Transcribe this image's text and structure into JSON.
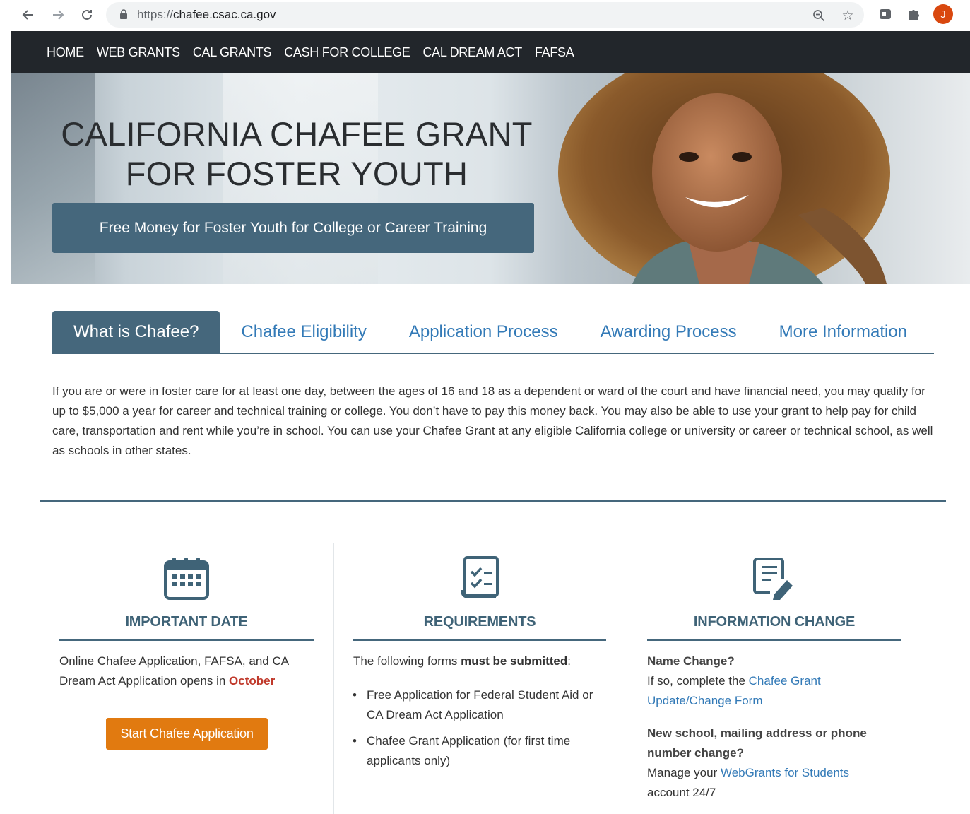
{
  "browser": {
    "url_scheme": "https://",
    "url_host": "chafee.csac.ca.gov",
    "avatar_initial": "J",
    "icons": [
      "back-icon",
      "forward-icon",
      "reload-icon",
      "lock-icon",
      "zoom-icon",
      "star-icon",
      "extension-icon",
      "puzzle-icon"
    ]
  },
  "site_nav": {
    "items": [
      "HOME",
      "WEB GRANTS",
      "CAL GRANTS",
      "CASH FOR COLLEGE",
      "CAL DREAM ACT",
      "FAFSA"
    ]
  },
  "hero": {
    "title_line1": "CALIFORNIA CHAFEE GRANT",
    "title_line2": "FOR FOSTER YOUTH",
    "cta": "Free Money for Foster Youth for College or Career Training"
  },
  "tabs": [
    {
      "label": "What is Chafee?",
      "active": true
    },
    {
      "label": "Chafee Eligibility",
      "active": false
    },
    {
      "label": "Application Process",
      "active": false
    },
    {
      "label": "Awarding Process",
      "active": false
    },
    {
      "label": "More Information",
      "active": false
    }
  ],
  "intro": "If you are or were in foster care for at least one day, between the ages of 16 and 18 as a dependent or ward of the court and have financial need, you may qualify for up to $5,000 a year for career and technical training or college. You don’t have to pay this money back. You may also be able to use your grant to help pay for child care, transportation and rent while you’re in school. You can use your Chafee Grant at any eligible California college or university or career or technical school, as well as schools in other states.",
  "cards": {
    "important_date": {
      "title": "IMPORTANT DATE",
      "text_before": "Online Chafee Application, FAFSA, and CA Dream Act Application opens in ",
      "highlight": "October",
      "button": "Start Chafee Application"
    },
    "requirements": {
      "title": "REQUIREMENTS",
      "intro_before": "The following forms ",
      "intro_bold": "must be submitted",
      "intro_after": ":",
      "items": [
        "Free Application for Federal Student Aid or CA Dream Act Application",
        "Chafee Grant Application (for first time applicants only)"
      ]
    },
    "information_change": {
      "title": "INFORMATION CHANGE",
      "q1": "Name Change?",
      "q1_text": "If so, complete the ",
      "q1_link": "Chafee Grant Update/Change Form",
      "q2": "New school, mailing address or phone number change?",
      "q2_text": "Manage your ",
      "q2_link": "WebGrants for Students",
      "q2_after": " account 24/7"
    }
  },
  "colors": {
    "nav_bg": "#22262b",
    "brand_blue": "#45677c",
    "link_blue": "#337ab7",
    "orange": "#e17a10",
    "highlight_red": "#c0392b"
  }
}
